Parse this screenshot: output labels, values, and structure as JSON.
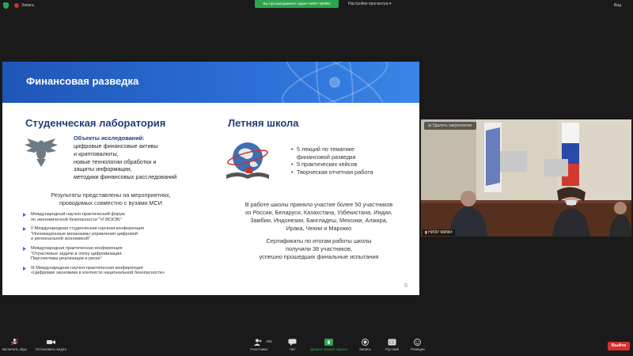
{
  "topbar": {
    "recording_label": "Запись",
    "share_banner": "Вы просматриваете экран НИЯУ МИФИ",
    "view_settings": "Настройки просмотра",
    "view_label": "Вид"
  },
  "slide": {
    "title": "Финансовая разведка",
    "left_title": "Студенческая лаборатория",
    "right_title": "Летняя школа",
    "research_head": "Объекты исследований:",
    "research_lines": [
      "цифровые финансовые активы",
      "и криптовалюты,",
      "новые технологии обработки и",
      "защиты информации,",
      "методики финансовых расследований"
    ],
    "results": [
      "Результаты представлены на мероприятиях,",
      "проводимых совместно с вузами МСИ"
    ],
    "conferences": [
      [
        "Международный научно-практический форум",
        "по экономической безопасности \"VI ВСКЭБ\""
      ],
      [
        "II Международная студенческая научная конференция",
        "\"Инновационные механизмы управления цифровой",
        "и региональной экономикой\""
      ],
      [
        "Международная практическая конференция",
        "\"Отраслевые задачи в эпоху цифровизации.",
        "Перспективы реализации и риски\""
      ],
      [
        "III Международная научно-практическая конференция",
        "«Цифровая экономика в контексте национальной безопасности»"
      ]
    ],
    "bullets": [
      "5 лекций по тематике",
      "финансовой разведки",
      "5 практических кейсов",
      "Творческая отчетная работа"
    ],
    "participants": [
      "В работе школы приняло участие более 50 участников",
      "из России, Беларуси, Казахстана, Узбекистана, Индии,",
      "Замбии, Индонезии, Бангладеш, Мексики, Алжира,",
      "Ирака, Чехии и Марокко"
    ],
    "certificates": [
      "Сертификаты по итогам работы школы",
      "получили 38 участников,",
      "успешно прошедших финальные испытания"
    ],
    "page_number": "6"
  },
  "video": {
    "unpin_label": "Удалить закрепление",
    "name": "НИЯУ МИФИ"
  },
  "toolbar": {
    "mic": "Включить звук",
    "video": "Остановить видео",
    "participants": "Участники",
    "participants_count": "155",
    "chat": "Чат",
    "share": "Демонстрация экрана",
    "record": "Запись",
    "captions": "Русский",
    "reactions": "Реакции",
    "leave": "Выйти"
  },
  "colors": {
    "accent_green": "#2ea44f",
    "leave_red": "#d6312a",
    "slide_header_blue": "#2563c9",
    "title_navy": "#1f3d7a"
  }
}
